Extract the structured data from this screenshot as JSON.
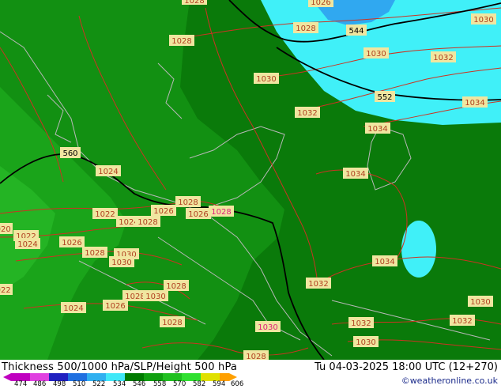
{
  "title": "Thickness 500/1000 hPa/SLP/Height 500 hPa",
  "valid_time": "Tu 04-03-2025 18:00 UTC (12+270)",
  "credit": "©weatheronline.co.uk",
  "legend": {
    "ticks": [
      "474",
      "486",
      "498",
      "510",
      "522",
      "534",
      "546",
      "558",
      "570",
      "582",
      "594",
      "606"
    ],
    "colors": [
      "#c000c0",
      "#e040e0",
      "#2020c0",
      "#2070e0",
      "#30b0f0",
      "#40e8f8",
      "#007a00",
      "#10a010",
      "#20c020",
      "#30e030",
      "#e0e000",
      "#ffa000"
    ]
  },
  "isobar_labels": [
    "1026",
    "1030",
    "1028",
    "544",
    "1028",
    "1030",
    "1032",
    "1030",
    "552",
    "1034",
    "1032",
    "1034",
    "560",
    "1024",
    "1034",
    "1028",
    "1022",
    "1026",
    "1026",
    "1028",
    "1024",
    "1028",
    "1022",
    "1024",
    "1026",
    "1028",
    "1030",
    "1030",
    "1034",
    "1028",
    "1030",
    "1032",
    "1030",
    "1024",
    "1026",
    "1028",
    "1032",
    "1030",
    "1030",
    "1032",
    "1028",
    "1022",
    "1020",
    "1028",
    "1028"
  ],
  "colors": {
    "dark_green": "#0a7a0a",
    "mid_green": "#149614",
    "light_green": "#22b022",
    "cyan": "#40f0f8",
    "sky": "#30a8f0",
    "isobar": "#cc3322",
    "border": "#b8b8b8",
    "contour": "#000000"
  }
}
